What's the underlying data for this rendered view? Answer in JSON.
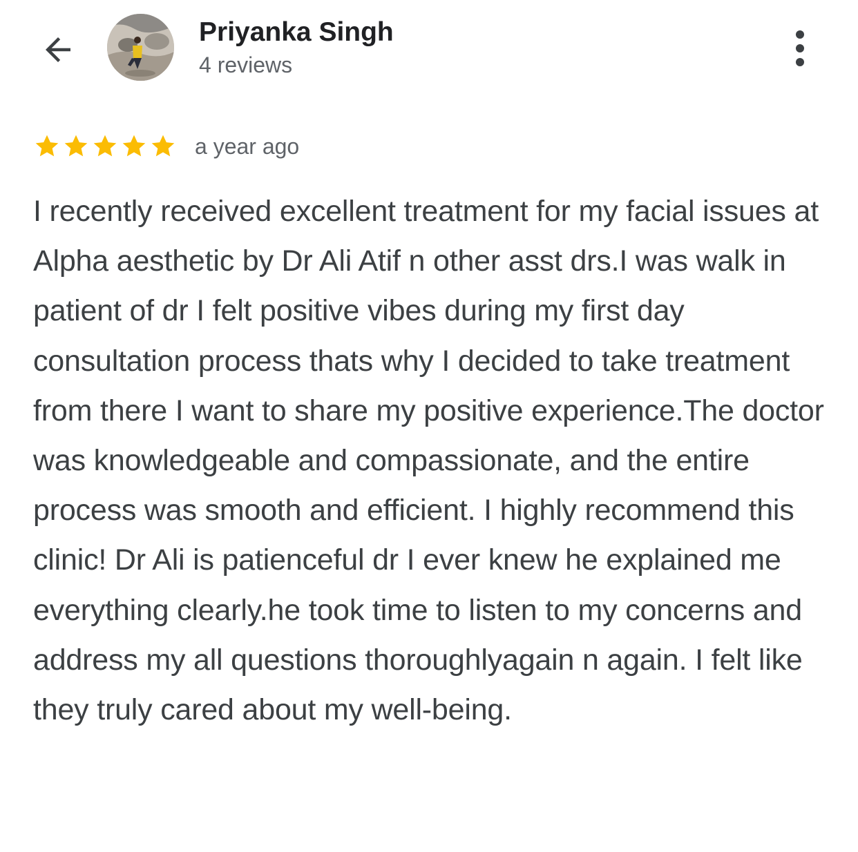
{
  "header": {
    "back_icon": "arrow-back-icon",
    "avatar_icon": "user-avatar",
    "user_name": "Priyanka Singh",
    "review_count": "4 reviews",
    "more_icon": "more-vert-icon"
  },
  "review": {
    "rating": 5,
    "rating_max": 5,
    "star_color": "#fbbc04",
    "time_ago": "a year ago",
    "text": "I recently received excellent treatment for my facial issues at Alpha aesthetic by Dr Ali Atif n other asst drs.I was walk in patient of dr I felt positive vibes during my first day consultation process thats why I decided to take treatment from there I want to share my positive experience.The doctor was knowledgeable and compassionate, and the entire process was smooth and efficient. I highly recommend this clinic! Dr Ali is patienceful dr I ever knew he explained me everything clearly.he took time to listen to my concerns and address my all questions thoroughlyagain n again. I felt like they truly cared about my well-being."
  }
}
